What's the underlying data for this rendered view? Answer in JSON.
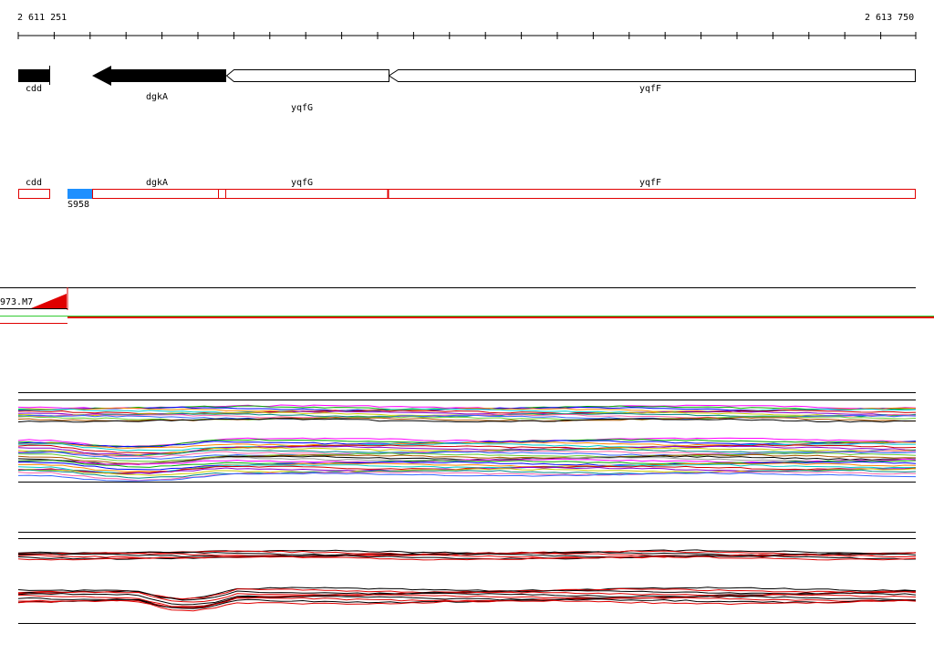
{
  "coords": {
    "start": "2 611 251",
    "end": "2 613 750"
  },
  "genes": [
    {
      "id": "cdd",
      "label": "cdd",
      "strand": "reverse",
      "fill": "black"
    },
    {
      "id": "dgkA",
      "label": "dgkA",
      "strand": "reverse",
      "fill": "black"
    },
    {
      "id": "yqfG",
      "label": "yqfG",
      "strand": "reverse",
      "fill": "white"
    },
    {
      "id": "yqfF",
      "label": "yqfF",
      "strand": "reverse",
      "fill": "white"
    }
  ],
  "segments": [
    {
      "label": "cdd"
    },
    {
      "label": "dgkA"
    },
    {
      "label": "yqfG"
    },
    {
      "label": "yqfF"
    }
  ],
  "site": {
    "label": "S958",
    "color": "#1e90ff"
  },
  "track": {
    "label": "973.M7"
  },
  "colors": {
    "segment_outline": "#e00000",
    "green_line": "#33cc33",
    "red_line": "#e00000"
  }
}
